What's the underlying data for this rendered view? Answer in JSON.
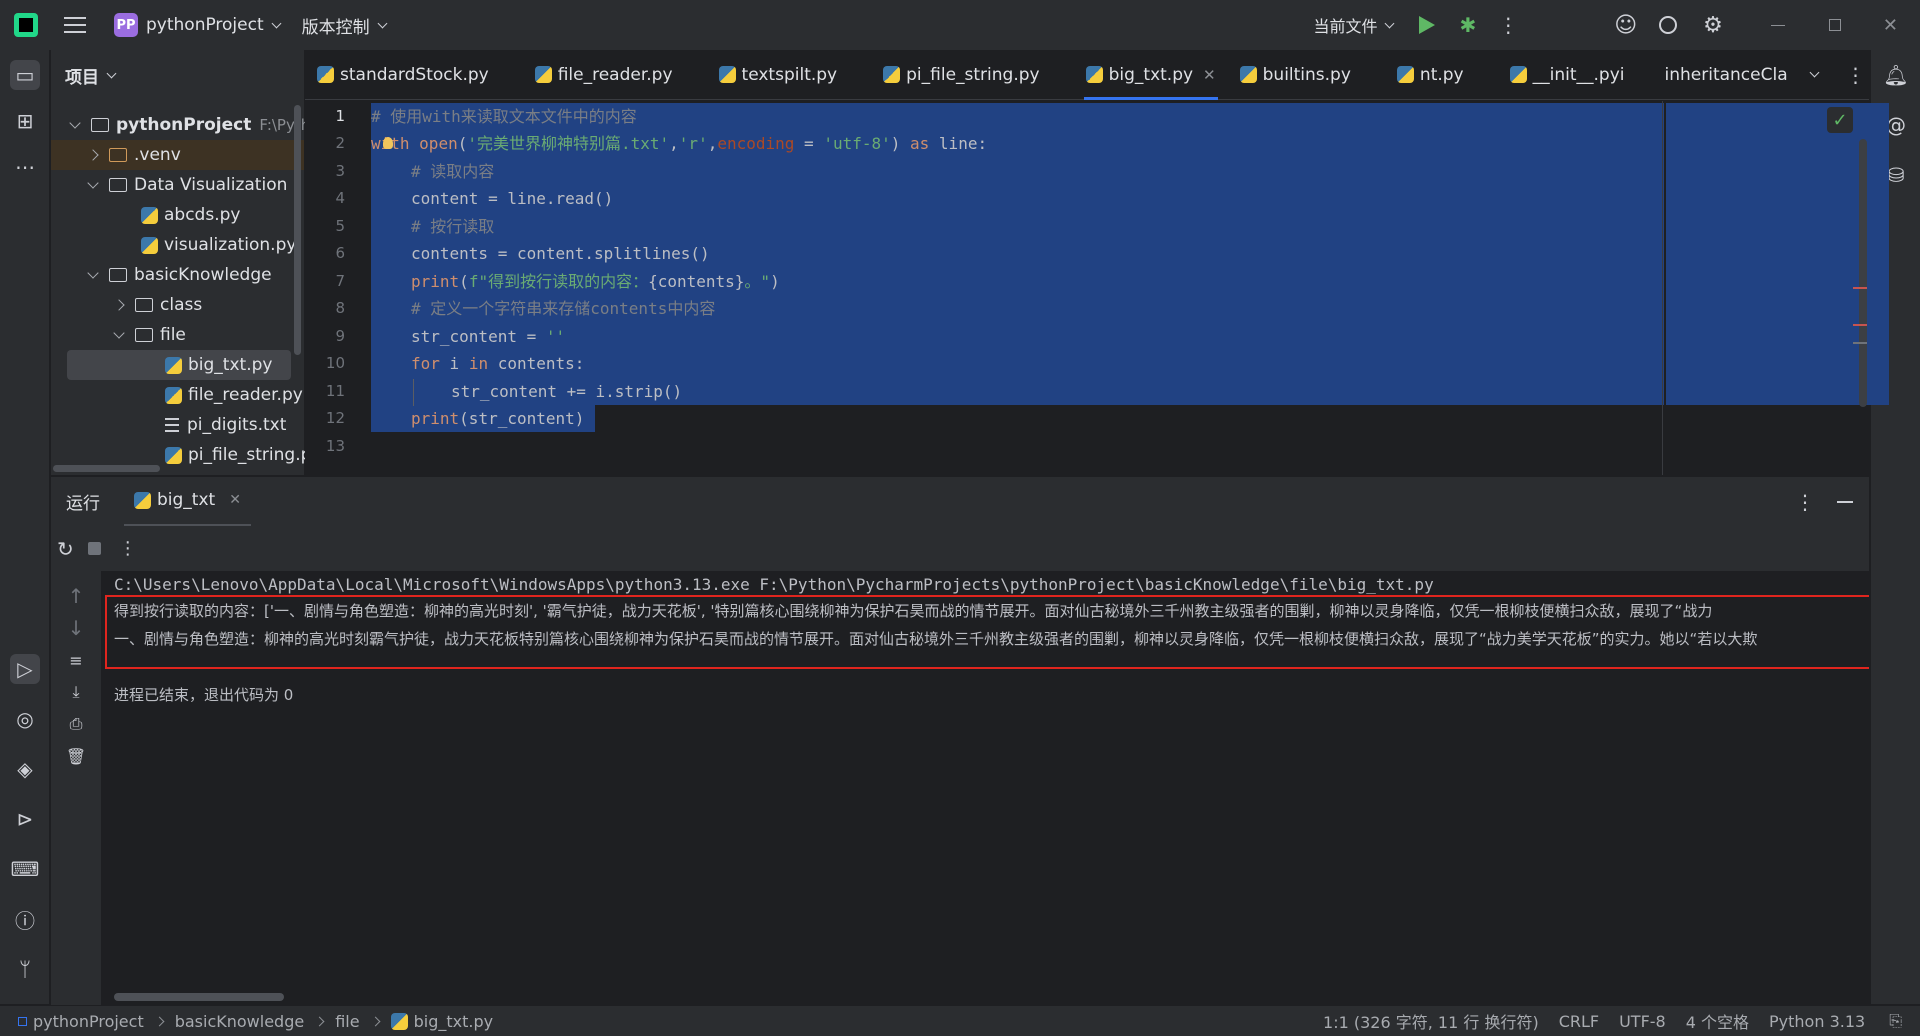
{
  "titlebar": {
    "project_badge": "PP",
    "project_name": "pythonProject",
    "vcs_label": "版本控制",
    "run_config": "当前文件"
  },
  "project_panel": {
    "title": "项目",
    "root_name": "pythonProject",
    "root_path": "F:\\Pytho",
    "items": [
      {
        "label": ".venv",
        "type": "folder"
      },
      {
        "label": "Data Visualization",
        "type": "folder"
      },
      {
        "label": "abcds.py",
        "type": "py"
      },
      {
        "label": "visualization.py",
        "type": "py"
      },
      {
        "label": "basicKnowledge",
        "type": "folder"
      },
      {
        "label": "class",
        "type": "folder"
      },
      {
        "label": "file",
        "type": "folder"
      },
      {
        "label": "big_txt.py",
        "type": "py"
      },
      {
        "label": "file_reader.py",
        "type": "py"
      },
      {
        "label": "pi_digits.txt",
        "type": "txt"
      },
      {
        "label": "pi_file_string.py",
        "type": "py"
      }
    ]
  },
  "tabs": [
    {
      "label": "standardStock.py"
    },
    {
      "label": "file_reader.py"
    },
    {
      "label": "textspilt.py"
    },
    {
      "label": "pi_file_string.py"
    },
    {
      "label": "big_txt.py",
      "active": true
    },
    {
      "label": "builtins.py"
    },
    {
      "label": "nt.py"
    },
    {
      "label": "__init__.pyi"
    },
    {
      "label": "inheritanceCla"
    }
  ],
  "editor": {
    "line_numbers": [
      "1",
      "2",
      "3",
      "4",
      "5",
      "6",
      "7",
      "8",
      "9",
      "10",
      "11",
      "12",
      "13"
    ],
    "lines": {
      "l1": "# 使用with来读取文本文件中的内容",
      "l2_kw": "with",
      "l2_open": "open",
      "l2_s1": "'完美世界柳神特别篇.txt'",
      "l2_s2": "'r'",
      "l2_param": "encoding",
      "l2_s3": "'utf-8'",
      "l2_as": "as",
      "l2_var": "line:",
      "l3": "# 读取内容",
      "l4": "content = line.read()",
      "l5": "# 按行读取",
      "l6": "contents = content.splitlines()",
      "l7_fn": "print",
      "l7_str": "f\"得到按行读取的内容：",
      "l7_var": "{contents}",
      "l7_end": "。\"",
      "l8": "# 定义一个字符串来存储contents中内容",
      "l9_var": "str_content = ",
      "l9_str": "''",
      "l10_for": "for",
      "l10_i": "i",
      "l10_in": "in",
      "l10_rest": "contents:",
      "l11": "str_content += i.strip()",
      "l12_fn": "print",
      "l12_rest": "(str_content)"
    }
  },
  "run_panel": {
    "title": "运行",
    "tab_label": "big_txt",
    "cmd_line": "C:\\Users\\Lenovo\\AppData\\Local\\Microsoft\\WindowsApps\\python3.13.exe F:\\Python\\PycharmProjects\\pythonProject\\basicKnowledge\\file\\big_txt.py",
    "output_line1": "得到按行读取的内容：['一、剧情与角色塑造：柳神的高光时刻', '霸气护徒，战力天花板', '特别篇核心围绕柳神为保护石昊而战的情节展开。面对仙古秘境外三千州教主级强者的围剿，柳神以灵身降临，仅凭一根柳枝便横扫众敌，展现了“战力",
    "output_line2": "一、剧情与角色塑造：柳神的高光时刻霸气护徒，战力天花板特别篇核心围绕柳神为保护石昊而战的情节展开。面对仙古秘境外三千州教主级强者的围剿，柳神以灵身降临，仅凭一根柳枝便横扫众敌，展现了“战力美学天花板”的实力。她以“若以大欺",
    "exit_line": "进程已结束，退出代码为  0"
  },
  "statusbar": {
    "crumbs": [
      "pythonProject",
      "basicKnowledge",
      "file",
      "big_txt.py"
    ],
    "position": "1:1 (326 字符, 11 行 换行符)",
    "line_sep": "CRLF",
    "encoding": "UTF-8",
    "indent": "4 个空格",
    "interpreter": "Python 3.13"
  }
}
